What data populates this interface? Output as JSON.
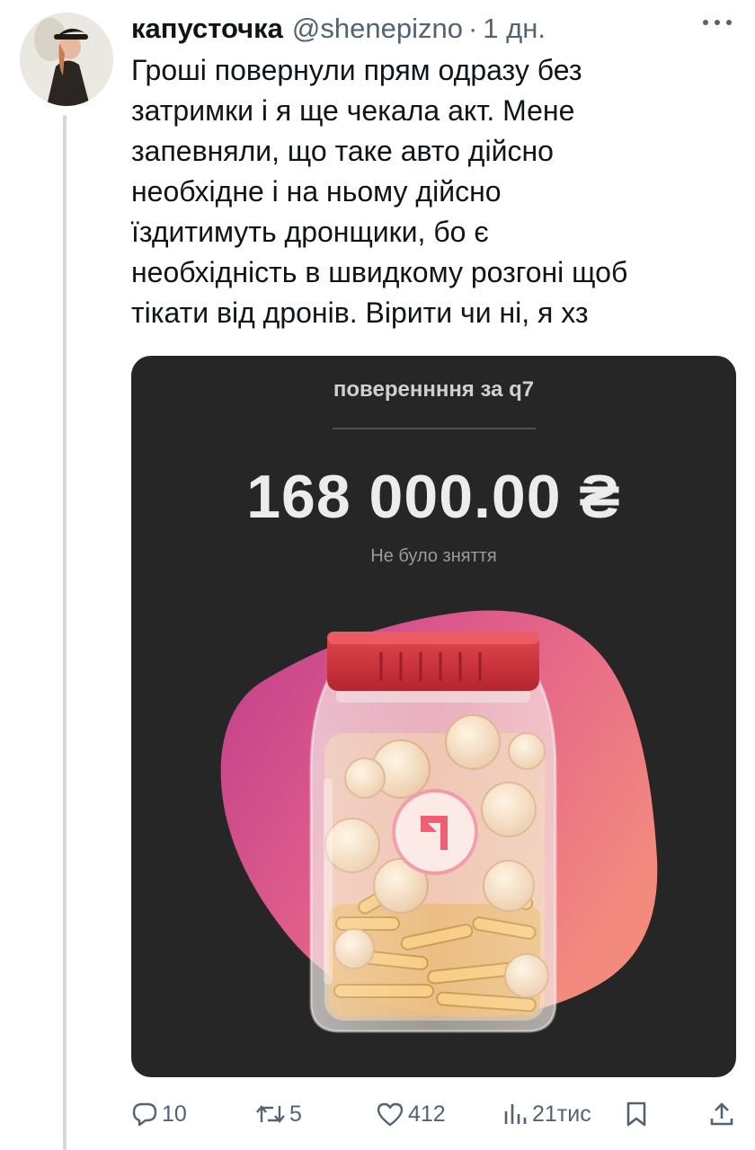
{
  "tweet": {
    "author": {
      "display_name": "капусточка",
      "handle": "@shenepizno",
      "separator": "·",
      "time": "1 дн."
    },
    "text_lines": [
      "Гроші повернули прям одразу без",
      "затримки і я ще чекала акт. Мене",
      "запевняли, що таке авто дійсно",
      "необхідне і на ньому дійсно",
      "їздитимуть дронщики, бо є",
      "необхідність в швидкому розгоні щоб",
      "тікати від дронів. Вірити чи ні, я хз"
    ],
    "media": {
      "title": "повереннння за q7",
      "amount": "168 000.00 ₴",
      "subtitle": "Не було зняття"
    },
    "actions": {
      "replies": "10",
      "retweets": "5",
      "likes": "412",
      "views": "21тис"
    }
  },
  "colors": {
    "text": "#0f1419",
    "secondary": "#536471",
    "media_bg": "#262626",
    "jar_lid": "#d3323c",
    "blob_start": "#c13d8c",
    "blob_end": "#f28a7e"
  },
  "icons": [
    "more-icon",
    "reply-icon",
    "retweet-icon",
    "like-icon",
    "views-icon",
    "bookmark-icon",
    "share-icon"
  ]
}
